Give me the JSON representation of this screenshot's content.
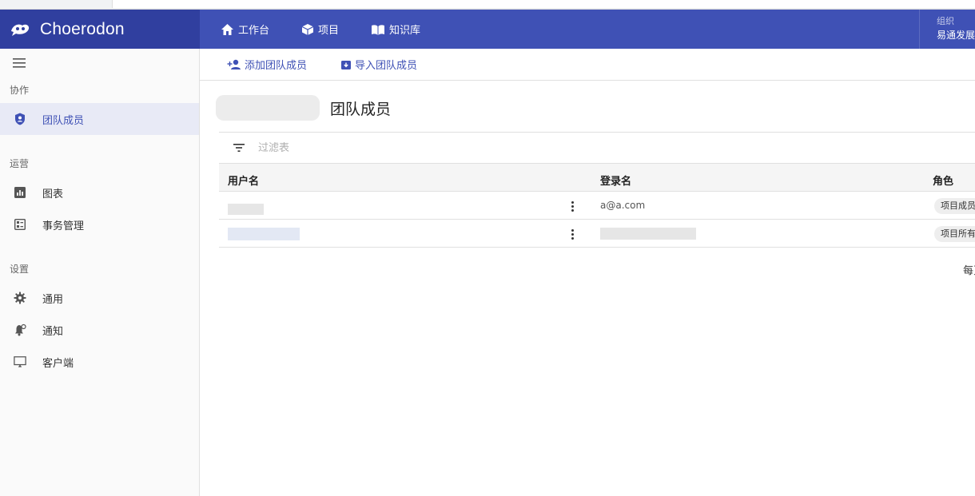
{
  "app": {
    "name": "Choerodon"
  },
  "nav": {
    "items": [
      {
        "label": "工作台"
      },
      {
        "label": "项目"
      },
      {
        "label": "知识库"
      }
    ]
  },
  "org": {
    "label": "组织",
    "name": "易通发展"
  },
  "sidebar": {
    "sections": [
      {
        "title": "协作",
        "items": [
          {
            "label": "团队成员",
            "icon": "shield-user-icon"
          }
        ]
      },
      {
        "title": "运营",
        "items": [
          {
            "label": "图表",
            "icon": "bar-chart-icon"
          },
          {
            "label": "事务管理",
            "icon": "task-board-icon"
          }
        ]
      },
      {
        "title": "设置",
        "items": [
          {
            "label": "通用",
            "icon": "gear-icon"
          },
          {
            "label": "通知",
            "icon": "bell-icon"
          },
          {
            "label": "客户端",
            "icon": "monitor-icon"
          }
        ]
      }
    ]
  },
  "actions": {
    "add_member": "添加团队成员",
    "import_member": "导入团队成员"
  },
  "page": {
    "title": "团队成员"
  },
  "filter": {
    "placeholder": "过滤表"
  },
  "table": {
    "columns": [
      "用户名",
      "登录名",
      "角色"
    ],
    "rows": [
      {
        "username": "",
        "login": "a@a.com",
        "role": "项目成员"
      },
      {
        "username": "",
        "login": "",
        "role": "项目所有者"
      }
    ]
  },
  "pager": {
    "label": "每页"
  },
  "colors": {
    "header": "#3f51b5",
    "logo_bg": "#303f9f",
    "accent": "#3f51b5",
    "active_bg": "#e8eaf6"
  }
}
